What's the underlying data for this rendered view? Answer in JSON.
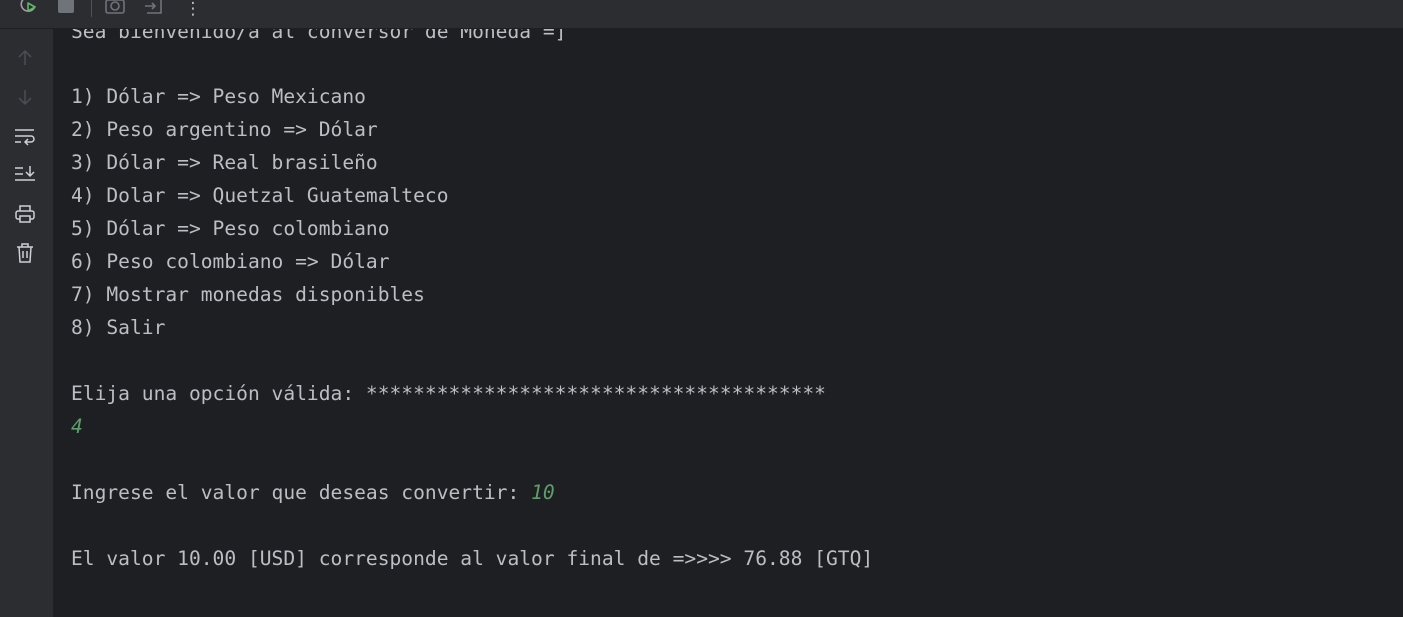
{
  "toolbar": {
    "rerun_icon": "rerun-icon",
    "stop_icon": "stop-icon",
    "screenshot_icon": "camera-icon",
    "exit_icon": "exit-icon",
    "more_label": "⋮"
  },
  "gutter": {
    "icons": [
      "up-arrow-icon",
      "down-arrow-icon",
      "soft-wrap-icon",
      "scroll-to-end-icon",
      "print-icon",
      "trash-icon"
    ]
  },
  "console": {
    "welcome": "Sea bienvenido/a al conversor de Moneda =]",
    "menu": [
      "1) Dólar => Peso Mexicano",
      "2) Peso argentino => Dólar",
      "3) Dólar => Real brasileño",
      "4) Dolar => Quetzal Guatemalteco",
      "5) Dólar => Peso colombiano",
      "6) Peso colombiano => Dólar",
      "7) Mostrar monedas disponibles",
      "8) Salir"
    ],
    "prompt_option": "Elija una opción válida: ***************************************",
    "option_input": "4",
    "prompt_value": "Ingrese el valor que deseas convertir: ",
    "value_input": "10",
    "result": "El valor 10.00 [USD] corresponde al valor final de =>>>> 76.88 [GTQ]"
  },
  "colors": {
    "background": "#1e1f22",
    "panel": "#2b2d30",
    "text": "#bcbec4",
    "user_input": "#5f9e6b"
  }
}
